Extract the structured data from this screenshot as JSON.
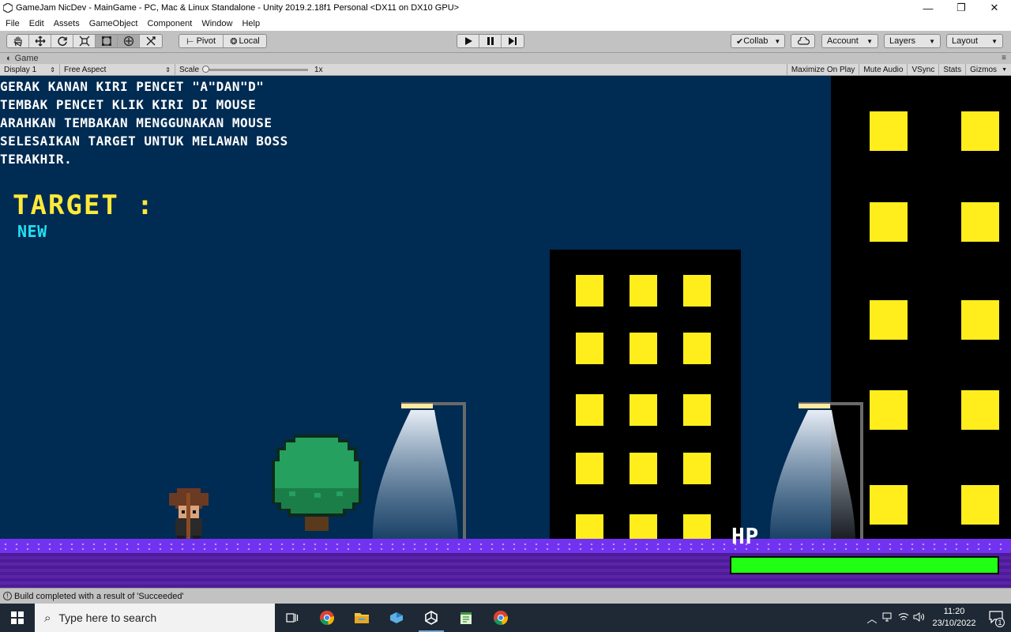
{
  "window": {
    "title": "GameJam NicDev - MainGame - PC, Mac & Linux Standalone - Unity 2019.2.18f1 Personal <DX11 on DX10 GPU>",
    "minimize": "—",
    "maximize": "❐",
    "close": "✕"
  },
  "menu": {
    "items": [
      {
        "label": "File"
      },
      {
        "label": "Edit"
      },
      {
        "label": "Assets"
      },
      {
        "label": "GameObject"
      },
      {
        "label": "Component"
      },
      {
        "label": "Window"
      },
      {
        "label": "Help"
      }
    ]
  },
  "toolbar": {
    "pivot_label": "Pivot",
    "local_label": "Local",
    "collab_label": "Collab",
    "account_label": "Account",
    "layers_label": "Layers",
    "layout_label": "Layout"
  },
  "game_tab": {
    "label": "Game",
    "display": "Display 1",
    "aspect": "Free Aspect",
    "scale_label": "Scale",
    "scale_value": "1x",
    "scale_fraction": 0.0,
    "maximize_on_play": "Maximize On Play",
    "mute_audio": "Mute Audio",
    "vsync": "VSync",
    "stats": "Stats",
    "gizmos": "Gizmos"
  },
  "game": {
    "instructions": [
      "GERAK KANAN KIRI PENCET \"A\"DAN\"D\"",
      "TEMBAK PENCET KLIK KIRI DI MOUSE",
      "ARAHKAN TEMBAKAN MENGGUNAKAN MOUSE",
      "SELESAIKAN TARGET UNTUK MELAWAN BOSS",
      "TERAKHIR."
    ],
    "target_label": "TARGET :",
    "target_value": "NEW",
    "hp_label": "HP",
    "hp_fraction": 1.0,
    "colors": {
      "sky": "#002b52",
      "window": "#ffee1c",
      "ground": "#7233f0",
      "hp": "#21ff14",
      "tree": "#25a05e"
    }
  },
  "status": {
    "message": "Build completed with a result of 'Succeeded'"
  },
  "taskbar": {
    "search_placeholder": "Type here to search",
    "apps": [
      "task-view-icon",
      "chrome-icon",
      "file-explorer-icon",
      "visual-studio-icon",
      "unity-icon",
      "notepad-icon",
      "chrome-icon"
    ],
    "time": "11:20",
    "date": "23/10/2022",
    "notification_count": "1"
  }
}
